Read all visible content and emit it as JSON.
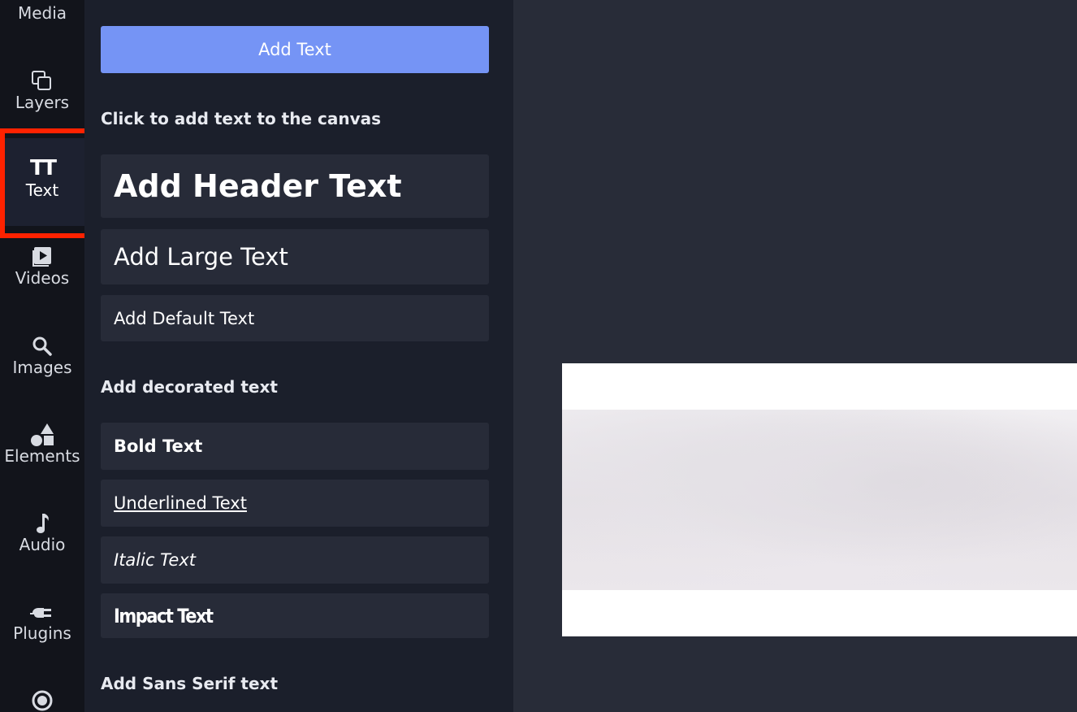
{
  "rail": {
    "items": [
      {
        "label": "Media",
        "icon": "media-icon"
      },
      {
        "label": "Layers",
        "icon": "layers-icon"
      },
      {
        "label": "Text",
        "icon": "text-icon",
        "active": true
      },
      {
        "label": "Videos",
        "icon": "video-icon"
      },
      {
        "label": "Images",
        "icon": "search-icon"
      },
      {
        "label": "Elements",
        "icon": "shapes-icon"
      },
      {
        "label": "Audio",
        "icon": "music-note-icon"
      },
      {
        "label": "Plugins",
        "icon": "plug-icon"
      },
      {
        "label": "",
        "icon": "record-icon"
      }
    ],
    "text_icon_glyph": "TT"
  },
  "panel": {
    "add_text_button": "Add Text",
    "hint": "Click to add text to the canvas",
    "basic_options": {
      "header": "Add Header Text",
      "large": "Add Large Text",
      "default": "Add Default Text"
    },
    "decorated_title": "Add decorated text",
    "decorated_options": {
      "bold": "Bold Text",
      "underlined": "Underlined Text",
      "italic": "Italic Text",
      "impact": "Impact Text"
    },
    "sans_serif_title": "Add Sans Serif text"
  },
  "colors": {
    "accent": "#7594f5",
    "highlight": "#ff2200",
    "panel_bg": "#1b1f2b",
    "rail_bg": "#12141b",
    "canvas_bg": "#282c38"
  }
}
